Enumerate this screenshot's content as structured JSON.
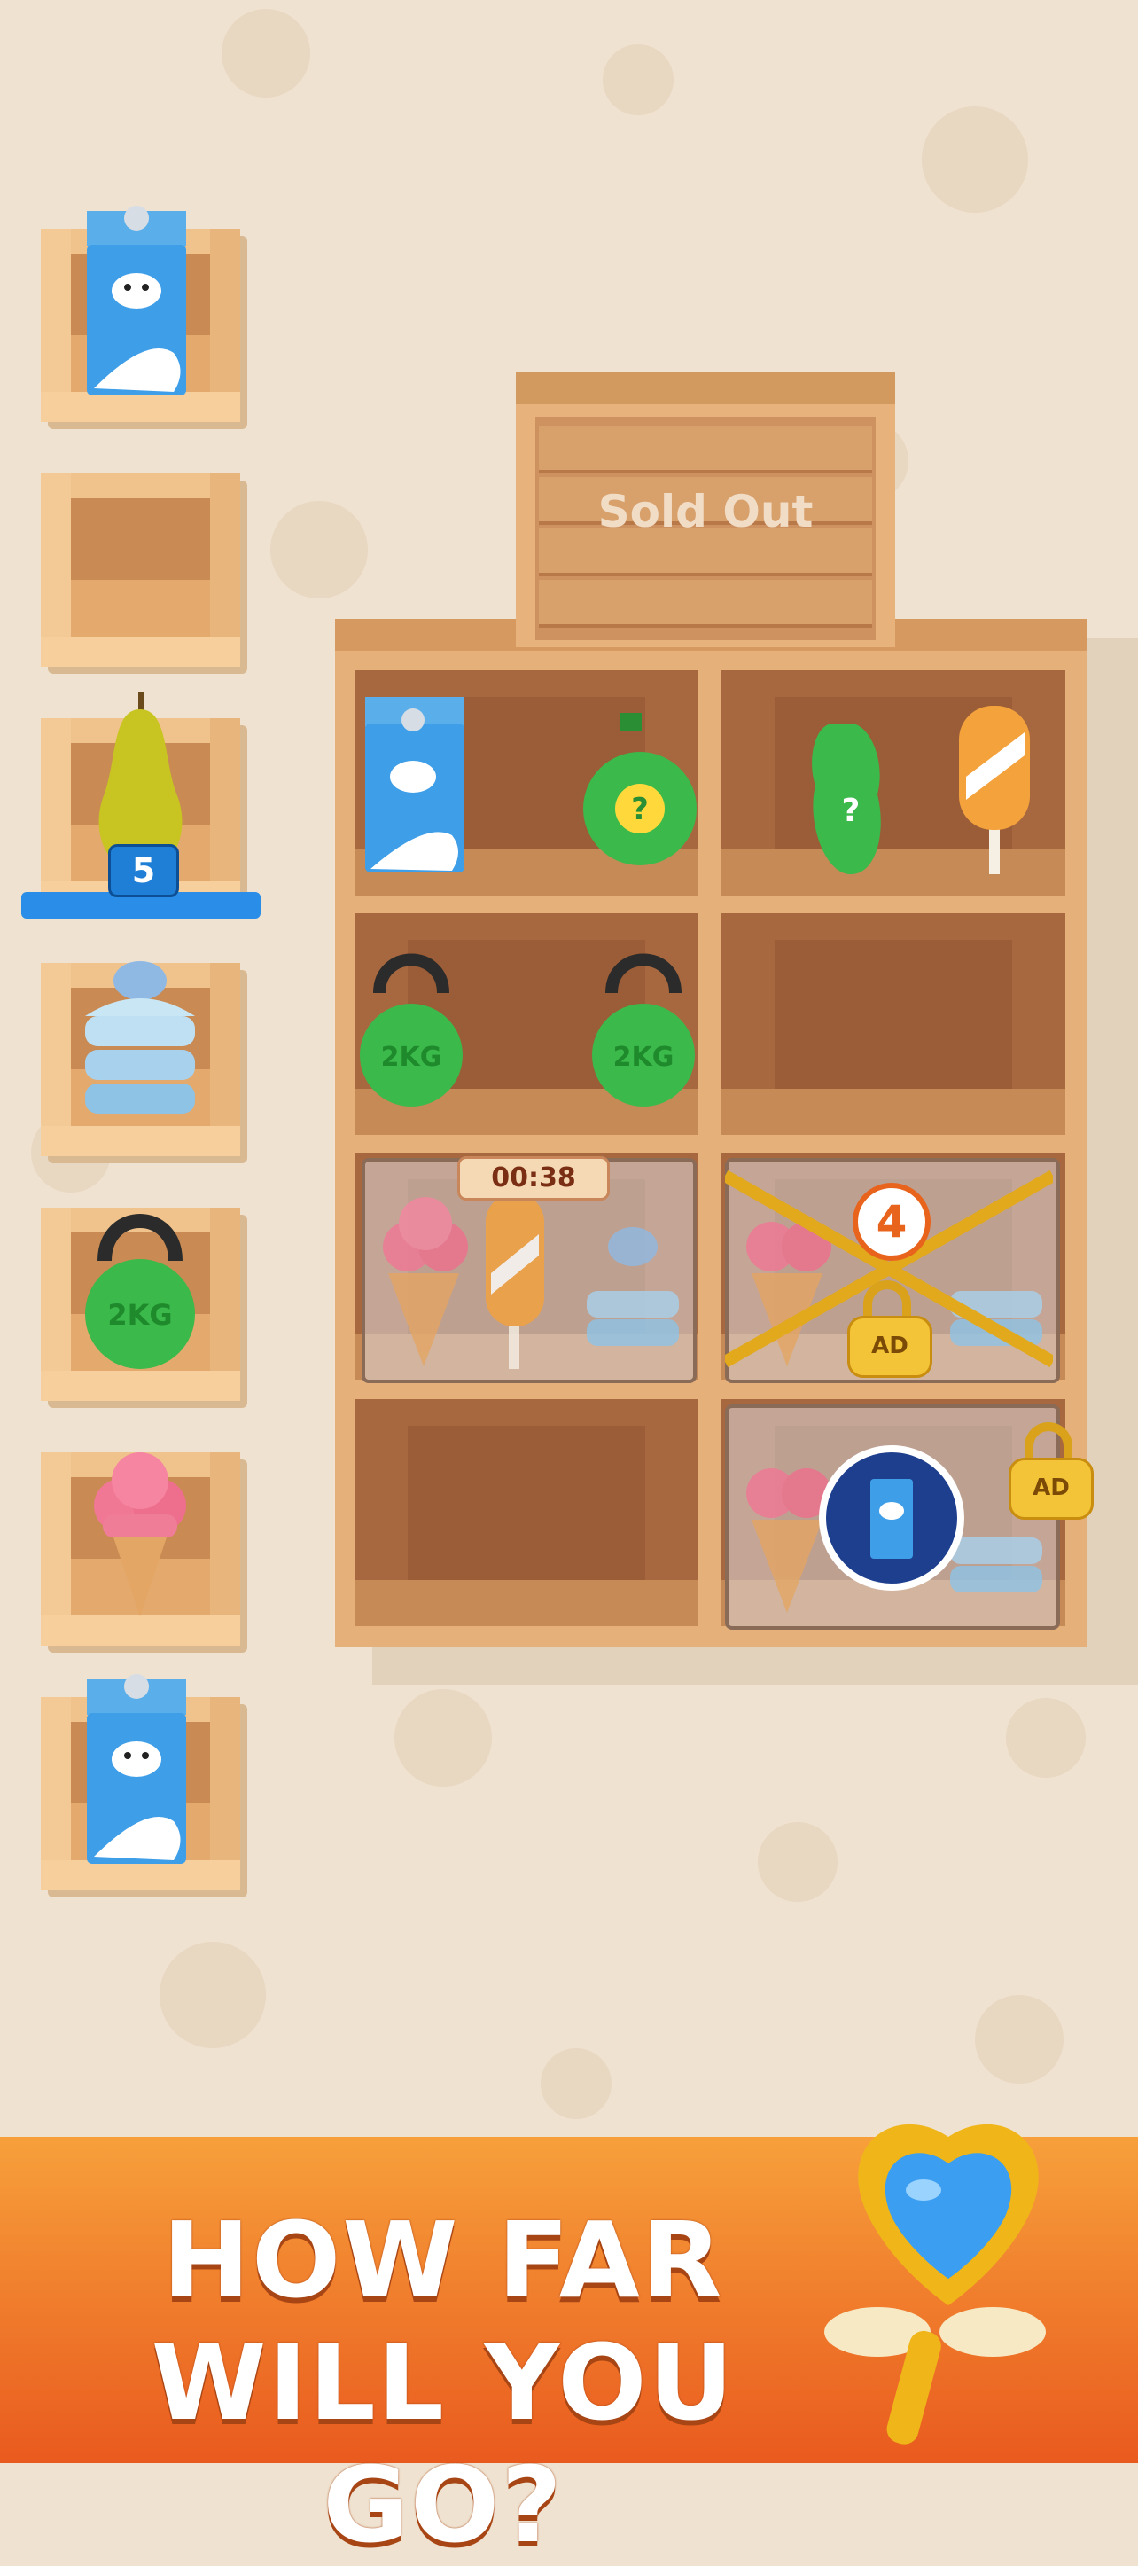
{
  "shelf": {
    "crate_label": "Sold Out",
    "timer": "00:38",
    "lock_count": "4",
    "lock_label": "AD",
    "corner_lock_label": "AD"
  },
  "side_boxes": [
    {
      "item": "milk-carton"
    },
    {
      "item": "empty"
    },
    {
      "item": "pear",
      "badge": "5"
    },
    {
      "item": "macaron-stack"
    },
    {
      "item": "kettlebell",
      "label": "2KG"
    },
    {
      "item": "ice-cream-cone"
    },
    {
      "item": "milk-carton"
    }
  ],
  "kettlebell_label": "2KG",
  "banner": {
    "line1": "HOW FAR",
    "line2": "WILL YOU GO?"
  },
  "colors": {
    "background": "#efe2d0",
    "wood_light": "#e6b07a",
    "wood_dark": "#a8683f",
    "banner": "#f08a30",
    "accent_blue": "#2c63c4"
  }
}
